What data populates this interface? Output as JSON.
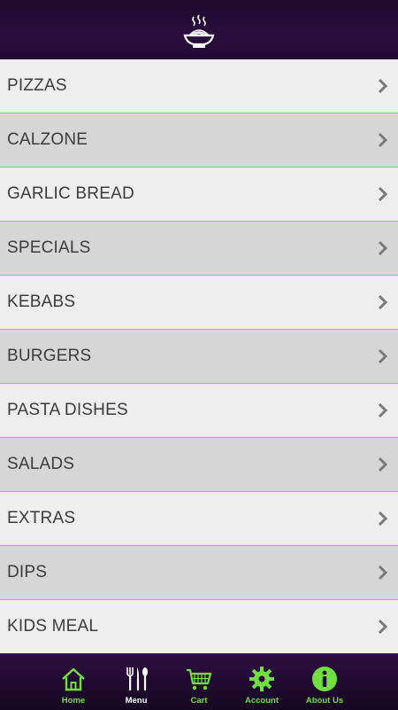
{
  "header": {
    "logo_icon": "noodle-bowl-icon"
  },
  "menu": {
    "items": [
      {
        "label": "PIZZAS"
      },
      {
        "label": "CALZONE"
      },
      {
        "label": "GARLIC BREAD"
      },
      {
        "label": "SPECIALS"
      },
      {
        "label": "KEBABS"
      },
      {
        "label": "BURGERS"
      },
      {
        "label": "PASTA DISHES"
      },
      {
        "label": "SALADS"
      },
      {
        "label": "EXTRAS"
      },
      {
        "label": "DIPS"
      },
      {
        "label": "KIDS MEAL"
      }
    ],
    "chevron_icon": "chevron-right-icon"
  },
  "tabbar": {
    "tabs": [
      {
        "label": "Home",
        "icon": "home-icon"
      },
      {
        "label": "Menu",
        "icon": "cutlery-icon",
        "active": true
      },
      {
        "label": "Cart",
        "icon": "cart-icon"
      },
      {
        "label": "Account",
        "icon": "gear-icon"
      },
      {
        "label": "About Us",
        "icon": "info-icon"
      }
    ],
    "accent_color": "#6fe03d",
    "active_color": "#ffffff"
  },
  "colors": {
    "header_bg": "#2a0e3f",
    "row_light": "#eeeeee",
    "row_dark": "#d6d6d6",
    "divider": "#6fd96f"
  }
}
